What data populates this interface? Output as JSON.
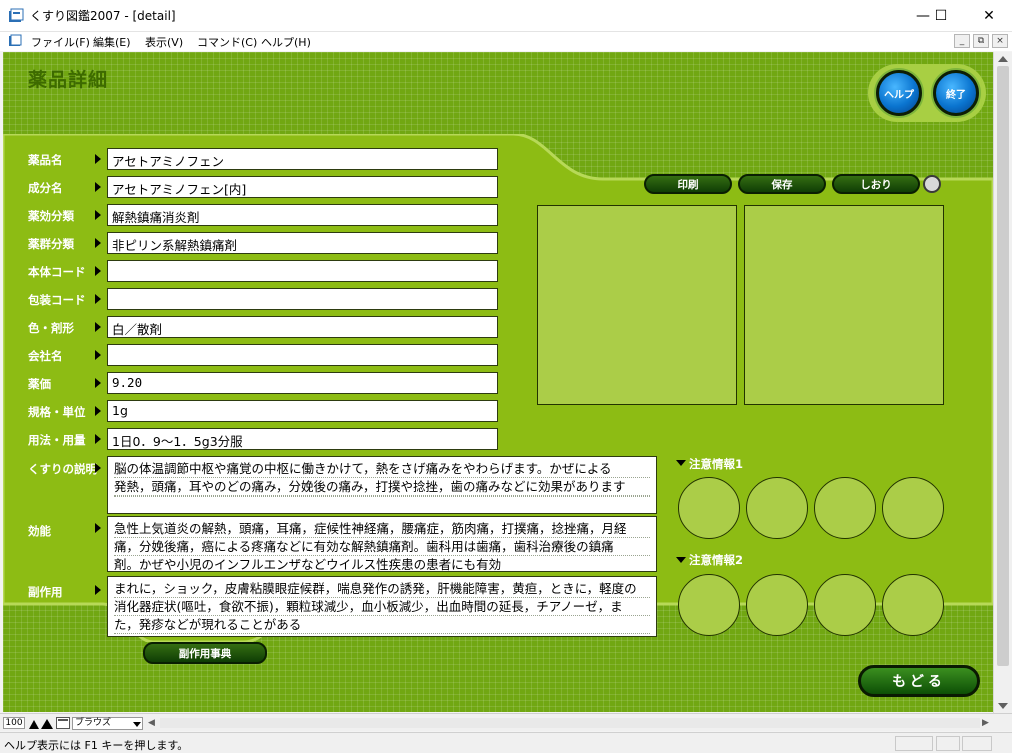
{
  "window": {
    "title": "くすり図鑑2007 - [detail]",
    "minimize": "—",
    "maximize": "☐",
    "close": "✕"
  },
  "menu": {
    "items": [
      "ファイル(F)",
      "編集(E)",
      "表示(V)",
      "コマンド(C)",
      "ヘルプ(H)"
    ],
    "mdi": [
      "_",
      "⧉",
      "×"
    ]
  },
  "page": {
    "title": "薬品詳細",
    "help_label": "ヘルプ",
    "exit_label": "終了",
    "back_label": "もどる",
    "side_effect_dict_label": "副作用事典"
  },
  "fields": [
    {
      "label": "薬品名",
      "value": "アセトアミノフェン"
    },
    {
      "label": "成分名",
      "value": "アセトアミノフェン[内]"
    },
    {
      "label": "薬効分類",
      "value": "解熱鎮痛消炎剤"
    },
    {
      "label": "薬群分類",
      "value": "非ピリン系解熱鎮痛剤"
    },
    {
      "label": "本体コード",
      "value": ""
    },
    {
      "label": "包装コード",
      "value": ""
    },
    {
      "label": "色・剤形",
      "value": "白／散剤"
    },
    {
      "label": "会社名",
      "value": ""
    },
    {
      "label": "薬価",
      "value": "9.20"
    },
    {
      "label": "規格・単位",
      "value": "1g"
    },
    {
      "label": "用法・用量",
      "value": "1日0．9～1．5g3分服"
    }
  ],
  "description": {
    "label": "くすりの説明",
    "lines": [
      "脳の体温調節中枢や痛覚の中枢に働きかけて，熱をさげ痛みをやわらげます。かぜによる",
      "発熱，頭痛，耳やのどの痛み，分娩後の痛み，打撲や捻挫，歯の痛みなどに効果があります",
      ""
    ]
  },
  "efficacy": {
    "label": "効能",
    "lines": [
      "急性上気道炎の解熱，頭痛，耳痛，症候性神経痛，腰痛症，筋肉痛，打撲痛，捻挫痛，月経",
      "痛，分娩後痛，癌による疼痛などに有効な解熱鎮痛剤。歯科用は歯痛，歯科治療後の鎮痛",
      "剤。かぜや小児のインフルエンザなどウイルス性疾患の患者にも有効"
    ]
  },
  "side_effects": {
    "label": "副作用",
    "lines": [
      "まれに，ショック，皮膚粘膜眼症候群，喘息発作の誘発，肝機能障害，黄疸，ときに，軽度の",
      "消化器症状(嘔吐，食欲不振)，顆粒球減少，血小板減少，出血時間の延長，チアノーゼ，ま",
      "た，発疹などが現れることがある"
    ]
  },
  "actions": {
    "print": "印刷",
    "save": "保存",
    "bookmark": "しおり"
  },
  "caution": {
    "section1": "注意情報1",
    "section2": "注意情報2"
  },
  "statusbar": {
    "zoom": "100",
    "mode": "ブラウズ",
    "help_text": "ヘルプ表示には F1 キーを押します。"
  },
  "colors": {
    "background": "#71a712",
    "panel": "#8dbc14",
    "panel_light": "#abcd48",
    "label_text": "#ffffff",
    "button_dark": "#0f3d05",
    "round_button": "#0a74cf"
  }
}
